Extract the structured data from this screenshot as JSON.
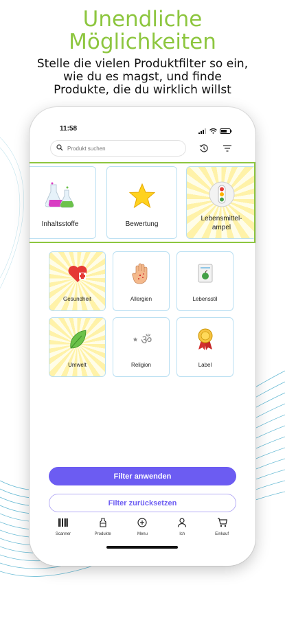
{
  "headline": {
    "title_line1": "Unendliche",
    "title_line2": "Möglichkeiten",
    "subtitle_line1": "Stelle die vielen Produktfilter so ein,",
    "subtitle_line2": "wie du es magst, und finde",
    "subtitle_line3": "Produkte, die du wirklich willst"
  },
  "status": {
    "time": "11:58"
  },
  "search": {
    "placeholder": "Produkt suchen"
  },
  "filters": {
    "inhaltsstoffe": "Inhaltsstoffe",
    "bewertung": "Bewertung",
    "ampel_line1": "Lebensmittel-",
    "ampel_line2": "ampel",
    "gesundheit": "Gesundheit",
    "allergien": "Allergien",
    "lebensstil": "Lebensstil",
    "umwelt": "Umwelt",
    "religion": "Religion",
    "label": "Label"
  },
  "buttons": {
    "apply": "Filter anwenden",
    "reset": "Filter zurücksetzen"
  },
  "tabbar": {
    "scanner": "Scanner",
    "produkte": "Produkte",
    "menu": "Menu",
    "ich": "Ich",
    "einkauf": "Einkauf"
  },
  "colors": {
    "accent": "#6c5cf2",
    "highlight": "#8dc63f",
    "tile_border": "#b9dff2"
  },
  "icons": [
    "search-icon",
    "history-icon",
    "filter-icon",
    "flask-icon",
    "star-icon",
    "traffic-light-icon",
    "heart-plus-icon",
    "hand-icon",
    "apple-document-icon",
    "leaf-icon",
    "religion-symbols-icon",
    "award-medal-icon",
    "barcode-icon",
    "products-icon",
    "plus-circle-icon",
    "person-icon",
    "cart-icon"
  ]
}
